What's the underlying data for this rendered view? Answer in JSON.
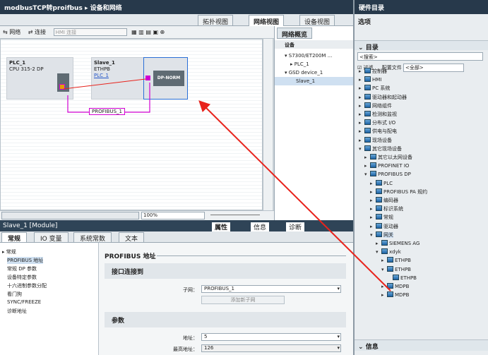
{
  "title": {
    "project": "modbusTCP转proifbus",
    "separator": "▸",
    "page": "设备和网络",
    "controls": "▪ ▪ ▪ ✕"
  },
  "view_tabs": {
    "topology": "拓扑视图",
    "network": "网络视图",
    "device": "设备视图"
  },
  "toolbar": {
    "network": "网络",
    "connection": "连接",
    "hmi_placeholder": "HMI 连接"
  },
  "canvas": {
    "plc": {
      "name": "PLC_1",
      "type": "CPU 315-2 DP"
    },
    "slave": {
      "name": "Slave_1",
      "type": "ETHPB",
      "link": "PLC_1",
      "module": "DP-NORM"
    },
    "bus_label": "PROFIBUS_1"
  },
  "zoom": "100%",
  "overview": {
    "tab": "网络概览",
    "header": "设备",
    "rows": [
      "S7300/ET200M ...",
      "PLC_1",
      "GSD device_1",
      "Slave_1"
    ]
  },
  "right": {
    "title": "硬件目录",
    "options": "选项",
    "catalog": "目录",
    "search_placeholder": "<搜索>",
    "filter": "过滤",
    "profile_label": "配置文件",
    "profile_value": "<全部>",
    "tree": [
      {
        "label": "控制器",
        "indent": 0,
        "exp": false
      },
      {
        "label": "HMI",
        "indent": 0,
        "exp": false
      },
      {
        "label": "PC 系统",
        "indent": 0,
        "exp": false
      },
      {
        "label": "驱动器和起动器",
        "indent": 0,
        "exp": false
      },
      {
        "label": "网络组件",
        "indent": 0,
        "exp": false
      },
      {
        "label": "检测和监视",
        "indent": 0,
        "exp": false
      },
      {
        "label": "分布式 I/O",
        "indent": 0,
        "exp": false
      },
      {
        "label": "供电与配电",
        "indent": 0,
        "exp": false
      },
      {
        "label": "现场设备",
        "indent": 0,
        "exp": false
      },
      {
        "label": "其它现场设备",
        "indent": 0,
        "exp": true
      },
      {
        "label": "其它以太网设备",
        "indent": 1,
        "exp": false
      },
      {
        "label": "PROFINET IO",
        "indent": 1,
        "exp": false
      },
      {
        "label": "PROFIBUS DP",
        "indent": 1,
        "exp": true
      },
      {
        "label": "PLC",
        "indent": 2,
        "exp": false
      },
      {
        "label": "PROFIBUS PA 规约",
        "indent": 2,
        "exp": false
      },
      {
        "label": "编码器",
        "indent": 2,
        "exp": false
      },
      {
        "label": "标识系统",
        "indent": 2,
        "exp": false
      },
      {
        "label": "常规",
        "indent": 2,
        "exp": false
      },
      {
        "label": "驱动器",
        "indent": 2,
        "exp": false
      },
      {
        "label": "网关",
        "indent": 2,
        "exp": true
      },
      {
        "label": "SIEMENS AG",
        "indent": 3,
        "exp": false
      },
      {
        "label": "xdyk",
        "indent": 3,
        "exp": true
      },
      {
        "label": "ETHPB",
        "indent": 4,
        "exp": false
      },
      {
        "label": "ETHPB",
        "indent": 4,
        "exp": true
      },
      {
        "label": "ETHPB",
        "indent": 5,
        "exp": null
      },
      {
        "label": "MDPB",
        "indent": 4,
        "exp": false
      },
      {
        "label": "MDPB",
        "indent": 4,
        "exp": false
      }
    ],
    "info": "信息"
  },
  "props": {
    "header": "Slave_1 [Module]",
    "prop": "属性",
    "info": "信息",
    "diag": "诊断",
    "tabs": [
      "常规",
      "IO 变量",
      "系统常数",
      "文本"
    ],
    "nav": [
      "常规",
      "PROFIBUS 地址",
      "常规 DP 参数",
      "设备特定参数",
      "十六进制参数分配",
      "看门狗",
      "SYNC/FREEZE",
      "诊断地址"
    ],
    "section_title": "PROFIBUS 地址",
    "interface": "接口连接到",
    "subnet_label": "子网：",
    "subnet_value": "PROFIBUS_1",
    "add_subnet": "添加新子网",
    "params": "参数",
    "addr_label": "地址：",
    "addr_value": "5",
    "max_label": "最高地址：",
    "max_value": "126"
  },
  "colors": {
    "titlebar": "#27394b",
    "profibus": "#d200d2",
    "arrow": "#e8231c"
  }
}
